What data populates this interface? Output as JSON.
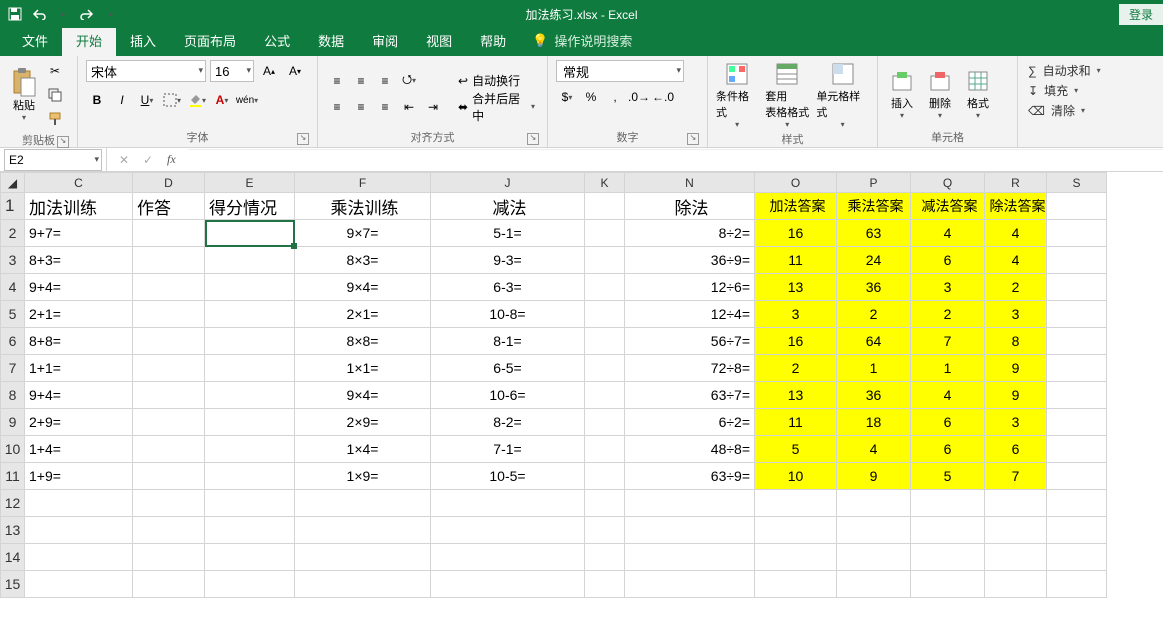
{
  "app": {
    "title": "加法练习.xlsx  -  Excel",
    "login": "登录"
  },
  "qat": {
    "save": "save",
    "undo": "undo",
    "redo": "redo"
  },
  "tabs": {
    "file": "文件",
    "home": "开始",
    "insert": "插入",
    "pagelayout": "页面布局",
    "formulas": "公式",
    "data": "数据",
    "review": "审阅",
    "view": "视图",
    "help": "帮助",
    "tellme": "操作说明搜索"
  },
  "ribbon": {
    "clipboard": {
      "label": "剪贴板",
      "paste": "粘贴"
    },
    "font": {
      "label": "字体",
      "name": "宋体",
      "size": "16"
    },
    "alignment": {
      "label": "对齐方式",
      "wrap": "自动换行",
      "merge": "合并后居中"
    },
    "number": {
      "label": "数字",
      "format": "常规"
    },
    "styles": {
      "label": "样式",
      "condfmt": "条件格式",
      "tablestyle": "套用\n表格格式",
      "cellstyle": "单元格样式"
    },
    "cells": {
      "label": "单元格",
      "insert": "插入",
      "delete": "删除",
      "format": "格式"
    },
    "editing": {
      "autosum": "自动求和",
      "fill": "填充",
      "clear": "清除"
    }
  },
  "cellref": "E2",
  "formula": "",
  "columns": [
    "C",
    "D",
    "E",
    "F",
    "J",
    "K",
    "N",
    "O",
    "P",
    "Q",
    "R",
    "S"
  ],
  "headerRow": {
    "c": "加法训练",
    "d": "作答",
    "e": "得分情况",
    "f": "乘法训练",
    "j": "减法",
    "k": "",
    "n": "除法",
    "o": "加法答案",
    "p": "乘法答案",
    "q": "减法答案",
    "r": "除法答案",
    "s": ""
  },
  "rows": [
    {
      "n": 2,
      "c": "9+7=",
      "f": "9×7=",
      "j": "5-1=",
      "div": "8÷2=",
      "o": "16",
      "p": "63",
      "q": "4",
      "r": "4"
    },
    {
      "n": 3,
      "c": "8+3=",
      "f": "8×3=",
      "j": "9-3=",
      "div": "36÷9=",
      "o": "11",
      "p": "24",
      "q": "6",
      "r": "4"
    },
    {
      "n": 4,
      "c": "9+4=",
      "f": "9×4=",
      "j": "6-3=",
      "div": "12÷6=",
      "o": "13",
      "p": "36",
      "q": "3",
      "r": "2"
    },
    {
      "n": 5,
      "c": "2+1=",
      "f": "2×1=",
      "j": "10-8=",
      "div": "12÷4=",
      "o": "3",
      "p": "2",
      "q": "2",
      "r": "3"
    },
    {
      "n": 6,
      "c": "8+8=",
      "f": "8×8=",
      "j": "8-1=",
      "div": "56÷7=",
      "o": "16",
      "p": "64",
      "q": "7",
      "r": "8"
    },
    {
      "n": 7,
      "c": "1+1=",
      "f": "1×1=",
      "j": "6-5=",
      "div": "72÷8=",
      "o": "2",
      "p": "1",
      "q": "1",
      "r": "9"
    },
    {
      "n": 8,
      "c": "9+4=",
      "f": "9×4=",
      "j": "10-6=",
      "div": "63÷7=",
      "o": "13",
      "p": "36",
      "q": "4",
      "r": "9"
    },
    {
      "n": 9,
      "c": "2+9=",
      "f": "2×9=",
      "j": "8-2=",
      "div": "6÷2=",
      "o": "11",
      "p": "18",
      "q": "6",
      "r": "3"
    },
    {
      "n": 10,
      "c": "1+4=",
      "f": "1×4=",
      "j": "7-1=",
      "div": "48÷8=",
      "o": "5",
      "p": "4",
      "q": "6",
      "r": "6"
    },
    {
      "n": 11,
      "c": "1+9=",
      "f": "1×9=",
      "j": "10-5=",
      "div": "63÷9=",
      "o": "10",
      "p": "9",
      "q": "5",
      "r": "7"
    }
  ],
  "emptyRows": [
    12,
    13,
    14,
    15
  ],
  "chart_data": null
}
